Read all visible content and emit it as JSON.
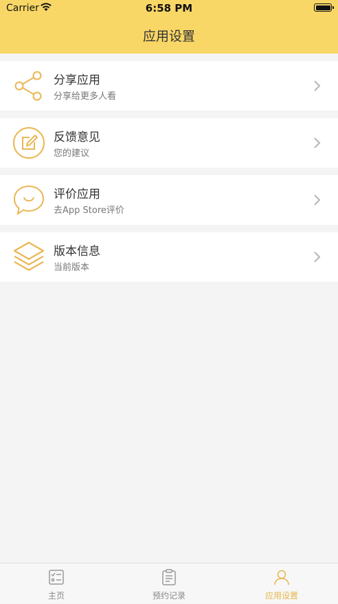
{
  "status": {
    "carrier": "Carrier",
    "time": "6:58 PM"
  },
  "nav": {
    "title": "应用设置"
  },
  "accent": "#f9d767",
  "icon_color": "#eab653",
  "items": [
    {
      "icon": "share-icon",
      "title": "分享应用",
      "subtitle": "分享给更多人看"
    },
    {
      "icon": "edit-icon",
      "title": "反馈意见",
      "subtitle": "您的建议"
    },
    {
      "icon": "chat-bubble-icon",
      "title": "评价应用",
      "subtitle": "去App Store评价"
    },
    {
      "icon": "layers-icon",
      "title": "版本信息",
      "subtitle": "当前版本"
    }
  ],
  "tabs": [
    {
      "icon": "checklist-icon",
      "label": "主页"
    },
    {
      "icon": "clipboard-icon",
      "label": "预约记录"
    },
    {
      "icon": "person-icon",
      "label": "应用设置",
      "active": true
    }
  ]
}
